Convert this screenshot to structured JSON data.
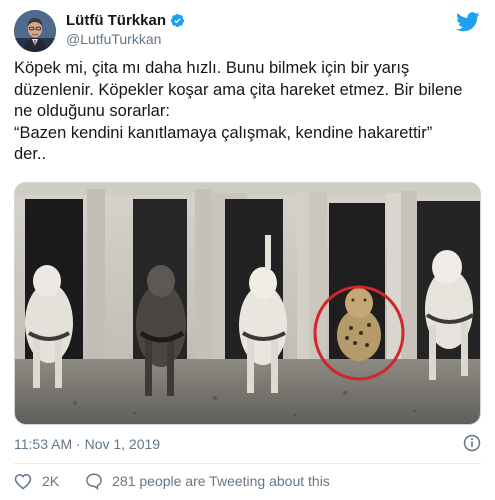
{
  "tweet": {
    "author": {
      "display_name": "Lütfü Türkkan",
      "handle": "@LutfuTurkkan",
      "verified": true
    },
    "text_lines": [
      "Köpek mi, çita mı daha hızlı. Bunu bilmek için bir yarış",
      "düzenlenir. Köpekler koşar ama çita hareket etmez. Bir bilene",
      "ne olduğunu sorarlar:",
      "“Bazen kendini kanıtlamaya çalışmak, kendine hakarettir”",
      "der.."
    ],
    "time": "11:53 AM",
    "separator": " · ",
    "date": "Nov 1, 2019",
    "likes": "2K",
    "tweeting_about": "281 people are Tweeting about this"
  },
  "icons": {
    "logo": "twitter-bird-icon",
    "verified": "verified-badge-icon",
    "info": "info-icon",
    "like": "heart-icon",
    "reply": "speech-bubble-icon"
  },
  "colors": {
    "brand": "#1da1f2",
    "text": "#14171a",
    "secondary": "#657786",
    "highlight_circle": "#d1262c"
  }
}
